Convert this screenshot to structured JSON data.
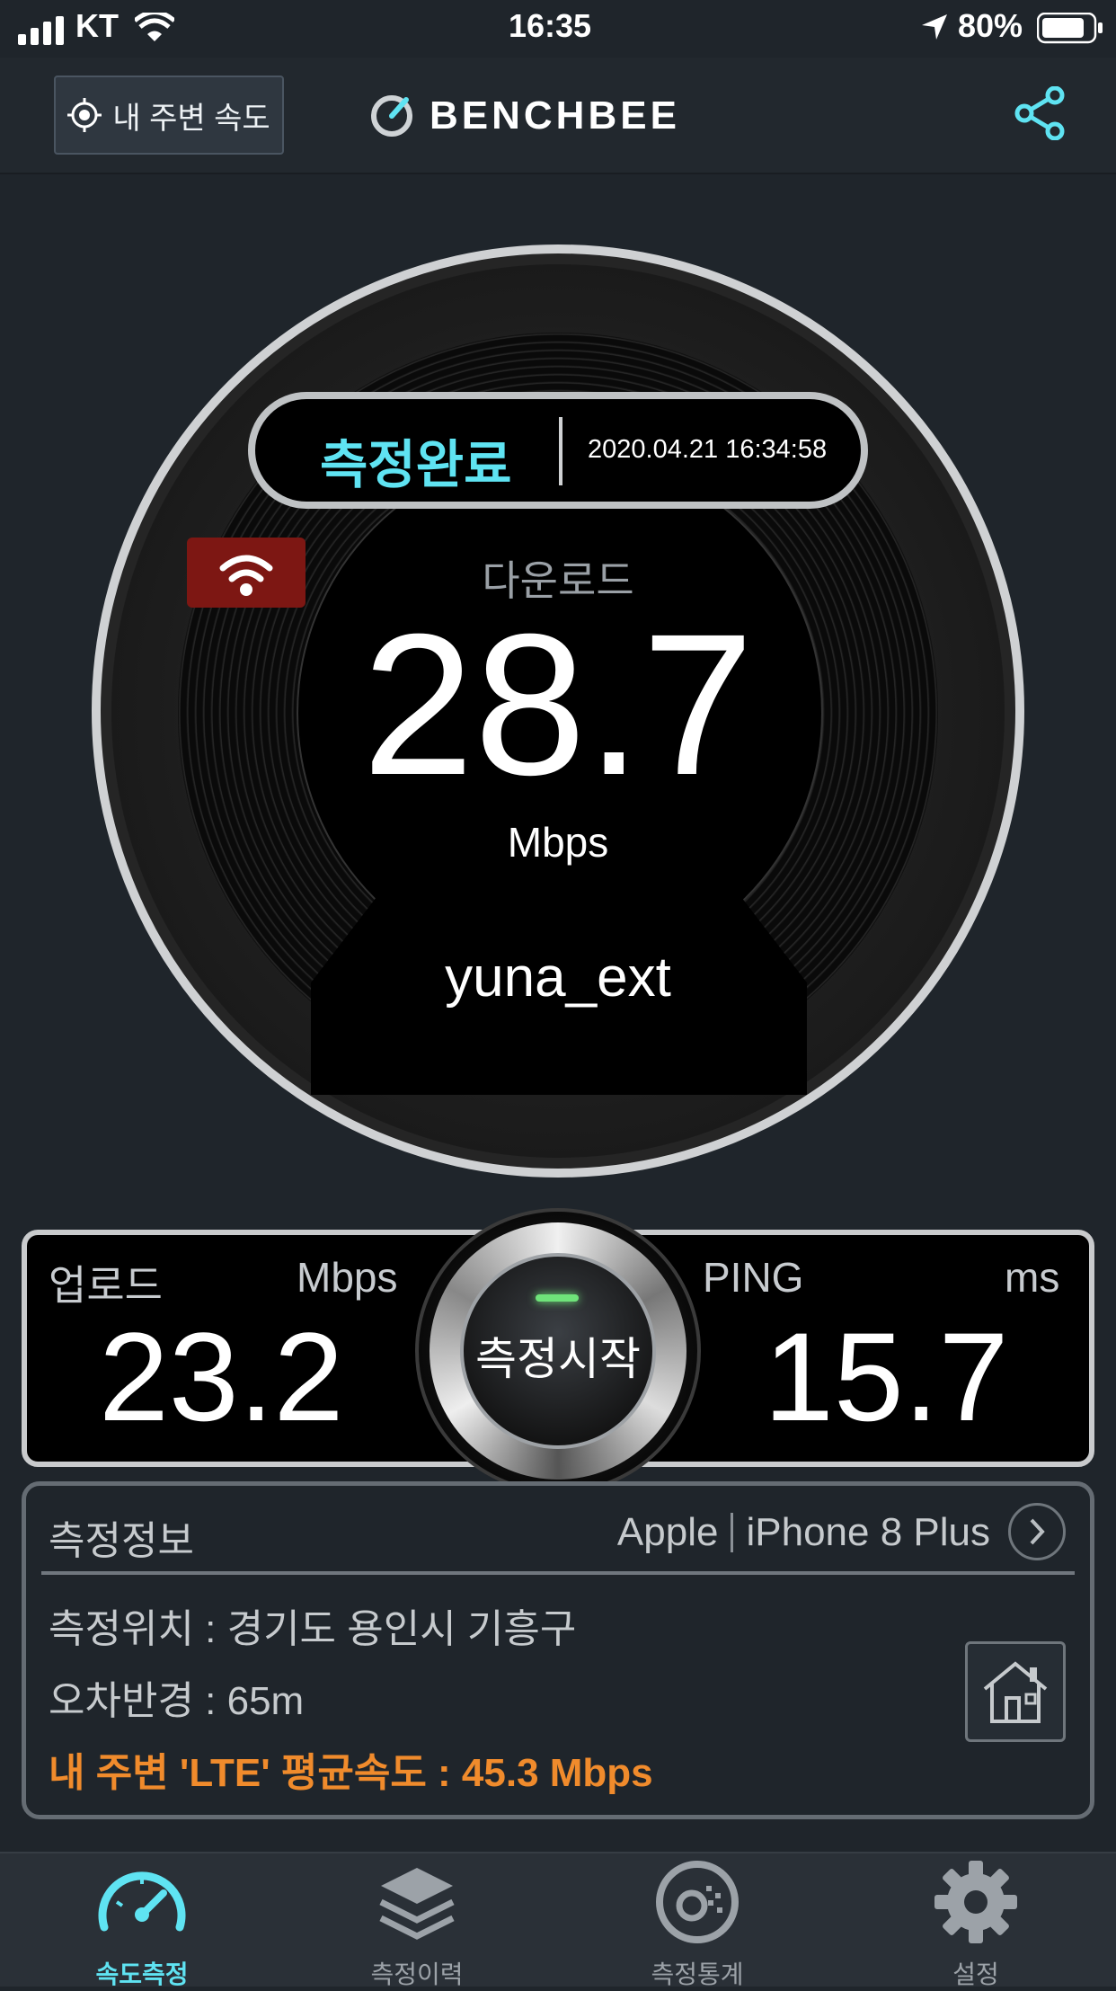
{
  "status_bar": {
    "carrier": "KT",
    "time": "16:35",
    "battery": "80%"
  },
  "header": {
    "nearby_button": "내 주변 속도",
    "logo": "BENCHBEE",
    "icons": {
      "nearby": "target-icon",
      "share": "share-icon"
    },
    "accent_color": "#5fe3f2"
  },
  "gauge": {
    "status": "측정완료",
    "timestamp": "2020.04.21 16:34:58",
    "label": "다운로드",
    "value": "28.7",
    "unit": "Mbps",
    "ssid": "yuna_ext",
    "connection_icon": "wifi-icon"
  },
  "results": {
    "upload_label": "업로드",
    "upload_unit": "Mbps",
    "upload_value": "23.2",
    "ping_label": "PING",
    "ping_unit": "ms",
    "ping_value": "15.7",
    "start_button": "측정시작"
  },
  "info": {
    "title": "측정정보",
    "brand": "Apple",
    "model": "iPhone 8 Plus",
    "location": "측정위치 : 경기도 용인시 기흥구",
    "error_radius": "오차반경 : 65m",
    "average": "내 주변 'LTE' 평균속도 : 45.3 Mbps",
    "highlight_color": "#f08b2c"
  },
  "tabs": [
    {
      "label": "속도측정",
      "icon": "speedometer-icon",
      "active": true
    },
    {
      "label": "측정이력",
      "icon": "layers-icon",
      "active": false
    },
    {
      "label": "측정통계",
      "icon": "statistics-icon",
      "active": false
    },
    {
      "label": "설정",
      "icon": "gear-icon",
      "active": false
    }
  ]
}
